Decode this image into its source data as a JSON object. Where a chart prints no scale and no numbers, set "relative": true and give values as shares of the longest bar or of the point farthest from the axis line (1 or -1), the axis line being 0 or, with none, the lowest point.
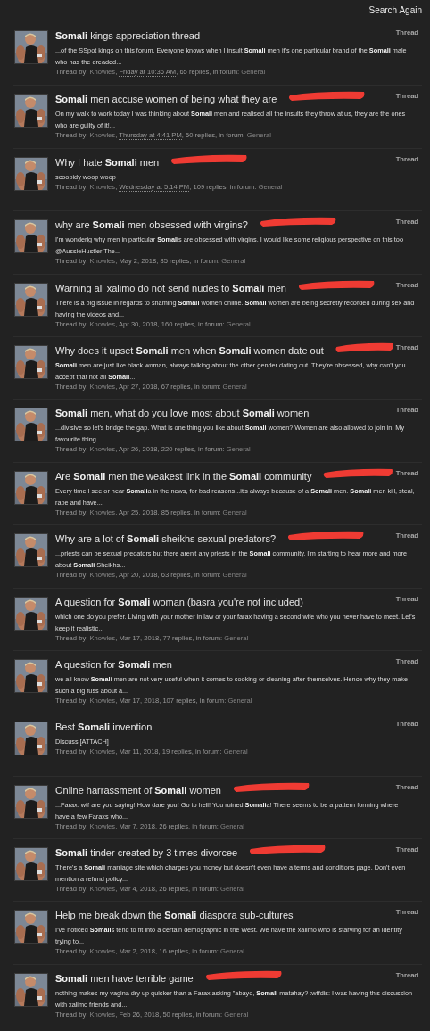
{
  "header": {
    "link": "Search Again"
  },
  "results": [
    {
      "title": "**Somali** kings appreciation thread",
      "type": "Thread",
      "redacted": false,
      "snippet": "...of the SSpot kings on this forum. Everyone knows when I insult **Somali** men it's one particular brand of the **Somali** male who has the dreaded...",
      "meta": {
        "prefix": "Thread by:",
        "author": "Knowles",
        "author_sep": ",",
        "date": "Friday at 10:36 AM",
        "date_sep": ",",
        "relative": true,
        "replies": "65 replies,",
        "forum_label": "in forum:",
        "forum": "General"
      }
    },
    {
      "title": "**Somali** men accuse women of being what they are",
      "type": "Thread",
      "redacted": true,
      "snippet": "On my walk to work today I was thinking about **Somali** men and realised all the insults they throw at us, they are the ones who are guilty of it!...",
      "meta": {
        "prefix": "Thread by:",
        "author": "Knowles",
        "author_sep": ",",
        "date": "Thursday at 4:41 PM",
        "date_sep": ",",
        "relative": true,
        "replies": "50 replies,",
        "forum_label": "in forum:",
        "forum": "General"
      }
    },
    {
      "title": "Why I hate **Somali** men",
      "type": "Thread",
      "redacted": true,
      "snippet": "scoopidy woop woop",
      "meta": {
        "prefix": "Thread by:",
        "author": "Knowles",
        "author_sep": ",",
        "date": "Wednesday at 5:14 PM",
        "date_sep": ",",
        "relative": true,
        "replies": "109 replies,",
        "forum_label": "in forum:",
        "forum": "General"
      }
    },
    {
      "title": "why are **Somali** men obsessed with virgins?",
      "type": "Thread",
      "redacted": true,
      "snippet": "I'm wonderig why men in particular **Somali**s are obsessed with virgins. I would like some religious perspective on this too @AussieHustler The...",
      "meta": {
        "prefix": "Thread by:",
        "author": "Knowles",
        "author_sep": ",",
        "date": "May 2, 2018,",
        "relative": false,
        "replies": "85 replies,",
        "forum_label": "in forum:",
        "forum": "General"
      }
    },
    {
      "title": "Warning all xalimo do not send nudes to **Somali** men",
      "type": "Thread",
      "redacted": true,
      "snippet": "There is a big issue in regards to shaming **Somali** women online. **Somali** women are being secretly recorded during sex and having the videos and...",
      "meta": {
        "prefix": "Thread by:",
        "author": "Knowles",
        "author_sep": ",",
        "date": "Apr 30, 2018,",
        "relative": false,
        "replies": "160 replies,",
        "forum_label": "in forum:",
        "forum": "General"
      }
    },
    {
      "title": "Why does it upset **Somali** men when **Somali** women date out",
      "type": "Thread",
      "redacted": true,
      "snippet": "**Somali** men are just like black woman, always talking about the other gender dating out. They're obsessed, why can't you accept that not all **Somali**...",
      "meta": {
        "prefix": "Thread by:",
        "author": "Knowles",
        "author_sep": ",",
        "date": "Apr 27, 2018,",
        "relative": false,
        "replies": "67 replies,",
        "forum_label": "in forum:",
        "forum": "General"
      }
    },
    {
      "title": "**Somali** men, what do you love most about **Somali** women",
      "type": "Thread",
      "redacted": false,
      "snippet": "...divisive so let's bridge the gap. What is one thing you like about **Somali** women? Women are also allowed to join in. My favourite thing...",
      "meta": {
        "prefix": "Thread by:",
        "author": "Knowles",
        "author_sep": ",",
        "date": "Apr 26, 2018,",
        "relative": false,
        "replies": "220 replies,",
        "forum_label": "in forum:",
        "forum": "General"
      }
    },
    {
      "title": "Are **Somali** men the weakest link in the **Somali** community",
      "type": "Thread",
      "redacted": true,
      "snippet": "Every time I see or hear **Somali**a in the news, for bad reasons...it's always because of a **Somali** men. **Somali** men kill, steal, rape and have...",
      "meta": {
        "prefix": "Thread by:",
        "author": "Knowles",
        "author_sep": ",",
        "date": "Apr 25, 2018,",
        "relative": false,
        "replies": "85 replies,",
        "forum_label": "in forum:",
        "forum": "General"
      }
    },
    {
      "title": "Why are a lot of **Somali** sheikhs sexual predators?",
      "type": "Thread",
      "redacted": true,
      "snippet": "...priests can be sexual predators but there aren't any priests in the **Somali** community. I'm starting to hear more and more about **Somali** Sheikhs...",
      "meta": {
        "prefix": "Thread by:",
        "author": "Knowles",
        "author_sep": ",",
        "date": "Apr 20, 2018,",
        "relative": false,
        "replies": "63 replies,",
        "forum_label": "in forum:",
        "forum": "General"
      }
    },
    {
      "title": "A question for **Somali** woman (basra you're not included)",
      "type": "Thread",
      "redacted": false,
      "snippet": "which one do you prefer. Living with your mother in law or your farax having a second wife who you never have to meet. Let's keep it realistic...",
      "meta": {
        "prefix": "Thread by:",
        "author": "Knowles",
        "author_sep": ",",
        "date": "Mar 17, 2018,",
        "relative": false,
        "replies": "77 replies,",
        "forum_label": "in forum:",
        "forum": "General"
      }
    },
    {
      "title": "A question for **Somali** men",
      "type": "Thread",
      "redacted": false,
      "snippet": "we all know **Somali** men are not very useful when it comes to cooking or cleaning after themselves. Hence why they make such a big fuss about a...",
      "meta": {
        "prefix": "Thread by:",
        "author": "Knowles",
        "author_sep": ",",
        "date": "Mar 17, 2018,",
        "relative": false,
        "replies": "107 replies,",
        "forum_label": "in forum:",
        "forum": "General"
      }
    },
    {
      "title": "Best **Somali** invention",
      "type": "Thread",
      "redacted": false,
      "snippet": "Discuss [ATTACH]",
      "meta": {
        "prefix": "Thread by:",
        "author": "Knowles",
        "author_sep": ",",
        "date": "Mar 11, 2018,",
        "relative": false,
        "replies": "19 replies,",
        "forum_label": "in forum:",
        "forum": "General"
      }
    },
    {
      "title": "Online harrassment of **Somali** women",
      "type": "Thread",
      "redacted": true,
      "snippet": "...Farax: wtf are you saying! How dare you! Go to hell! You ruined **Somali**a! There seems to be a pattern forming where I have a few Faraxs who...",
      "meta": {
        "prefix": "Thread by:",
        "author": "Knowles",
        "author_sep": ",",
        "date": "Mar 7, 2018,",
        "relative": false,
        "replies": "26 replies,",
        "forum_label": "in forum:",
        "forum": "General"
      }
    },
    {
      "title": "**Somali** tinder created by 3 times divorcee",
      "type": "Thread",
      "redacted": true,
      "snippet": "There's a **Somali** marriage site which charges you money but doesn't even have a terms and conditions page. Don't even mention a refund policy...",
      "meta": {
        "prefix": "Thread by:",
        "author": "Knowles",
        "author_sep": ",",
        "date": "Mar 4, 2018,",
        "relative": false,
        "replies": "26 replies,",
        "forum_label": "in forum:",
        "forum": "General"
      }
    },
    {
      "title": "Help me break down the **Somali** diaspora sub-cultures",
      "type": "Thread",
      "redacted": false,
      "snippet": "I've noticed **Somali**s tend to fit into a certain demographic in the West. We have the xalimo who is starving for an identity trying to...",
      "meta": {
        "prefix": "Thread by:",
        "author": "Knowles",
        "author_sep": ",",
        "date": "Mar 2, 2018,",
        "relative": false,
        "replies": "16 replies,",
        "forum_label": "in forum:",
        "forum": "General"
      }
    },
    {
      "title": "**Somali** men have terrible game",
      "type": "Thread",
      "redacted": true,
      "snippet": "nothing makes my vagina dry up quicker than a Farax asking \"abayo, **Somali** matahay? :wtfdis: I was having this discussion with xalimo friends and...",
      "meta": {
        "prefix": "Thread by:",
        "author": "Knowles",
        "author_sep": ",",
        "date": "Feb 26, 2018,",
        "relative": false,
        "replies": "50 replies,",
        "forum_label": "in forum:",
        "forum": "General"
      }
    }
  ]
}
